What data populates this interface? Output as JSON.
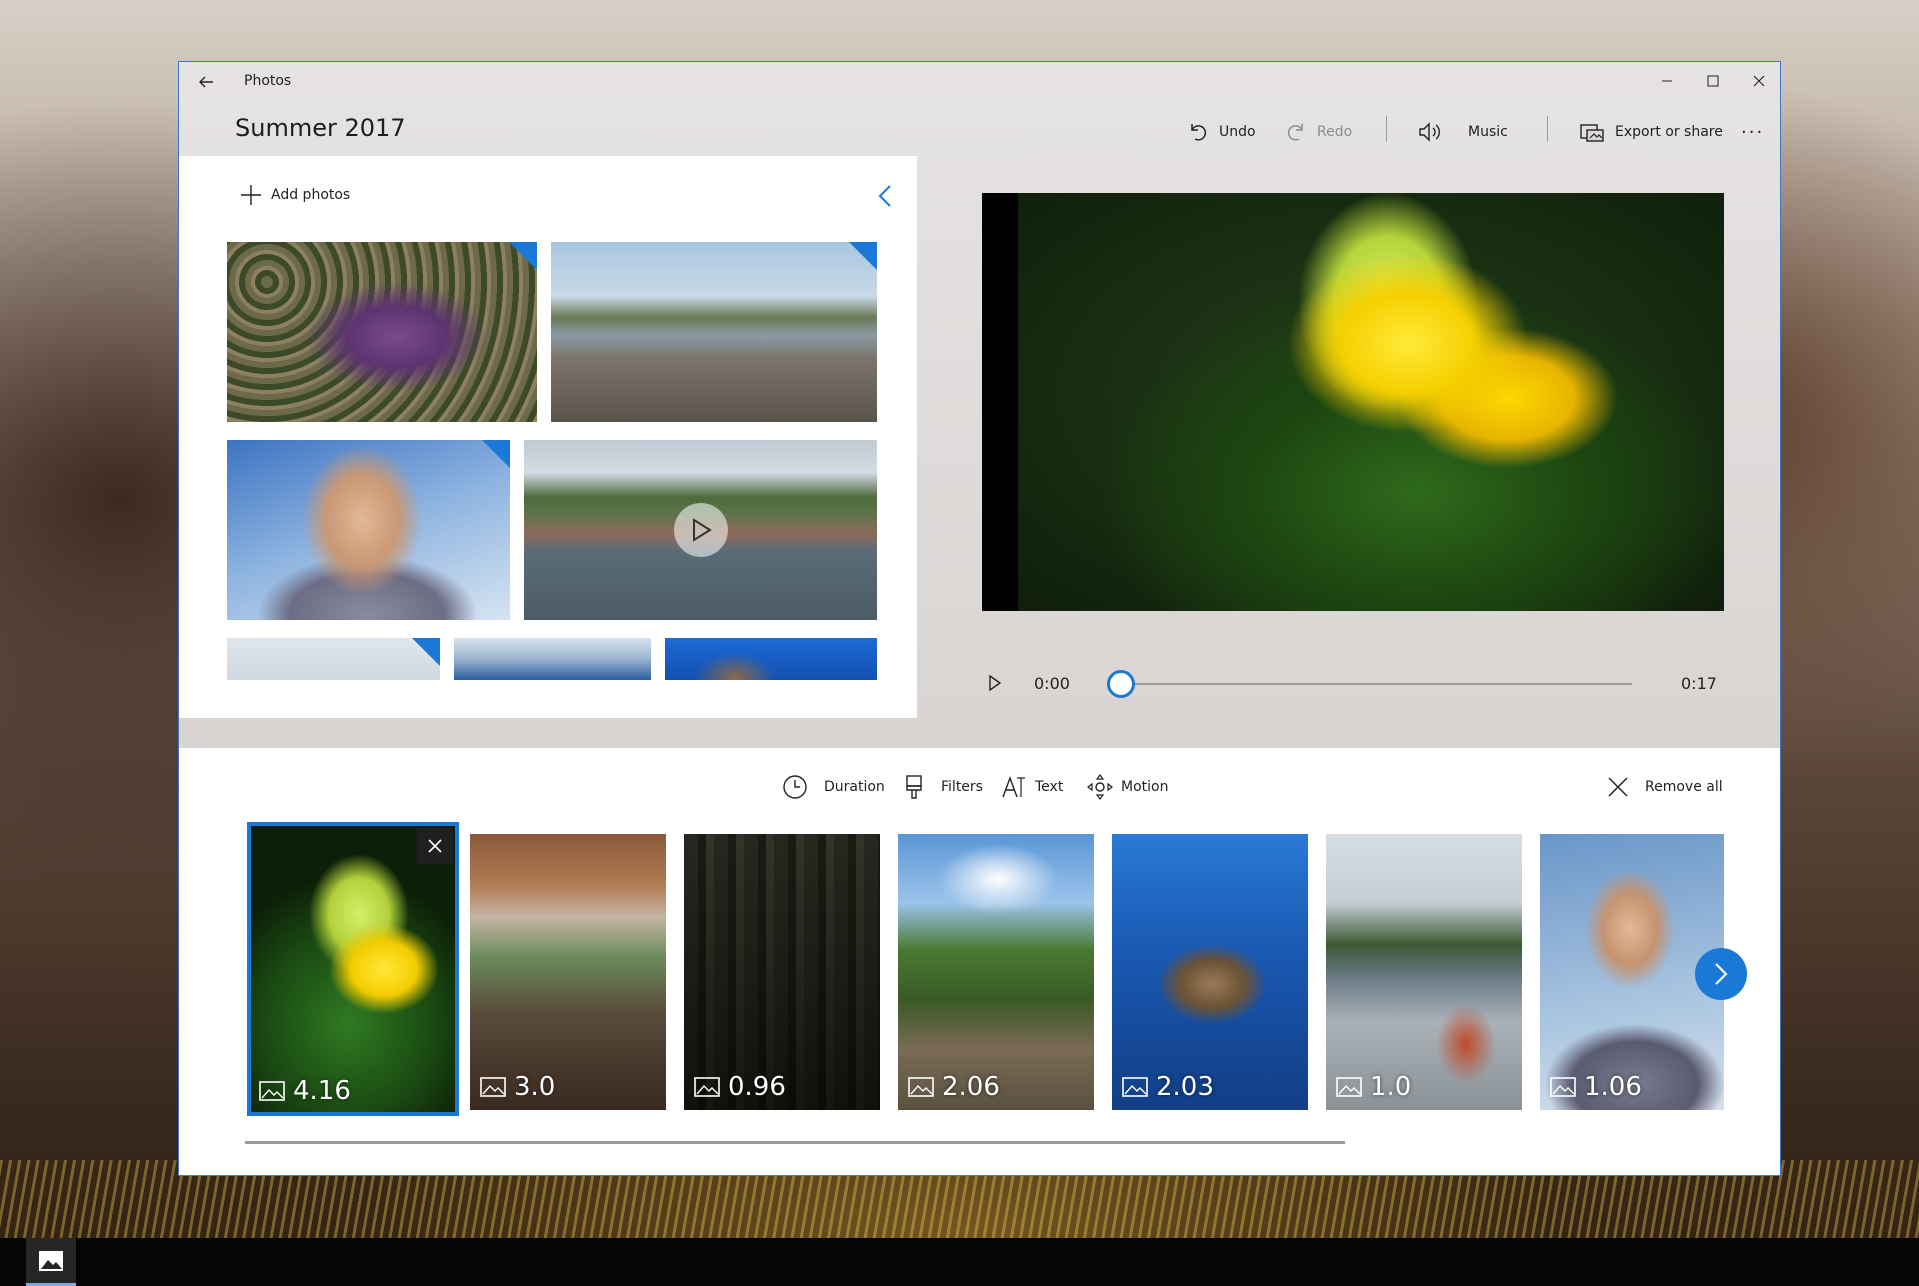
{
  "window": {
    "app_name": "Photos",
    "project_title": "Summer 2017"
  },
  "toolbar": {
    "undo_label": "Undo",
    "redo_label": "Redo",
    "music_label": "Music",
    "export_label": "Export or share",
    "more_label": "···"
  },
  "library": {
    "add_photos_label": "Add photos"
  },
  "player": {
    "current_time": "0:00",
    "total_time": "0:17",
    "progress": 0
  },
  "storyboard": {
    "tools": {
      "duration_label": "Duration",
      "filters_label": "Filters",
      "text_label": "Text",
      "motion_label": "Motion",
      "remove_all_label": "Remove all"
    },
    "clips": [
      {
        "duration": "4.16",
        "selected": true
      },
      {
        "duration": "3.0"
      },
      {
        "duration": "0.96"
      },
      {
        "duration": "2.06"
      },
      {
        "duration": "2.03"
      },
      {
        "duration": "1.0"
      },
      {
        "duration": "1.06"
      }
    ]
  },
  "colors": {
    "accent": "#1a78d6"
  },
  "icons": {
    "back": "back-arrow-icon",
    "undo": "undo-icon",
    "redo": "redo-icon",
    "music": "speaker-icon",
    "export": "export-icon",
    "more": "more-icon",
    "add": "plus-icon",
    "collapse": "chevron-left-icon",
    "play": "play-icon",
    "duration": "clock-icon",
    "filters": "brush-icon",
    "text": "text-icon",
    "motion": "motion-icon",
    "remove": "close-icon",
    "next": "chevron-right-icon"
  }
}
